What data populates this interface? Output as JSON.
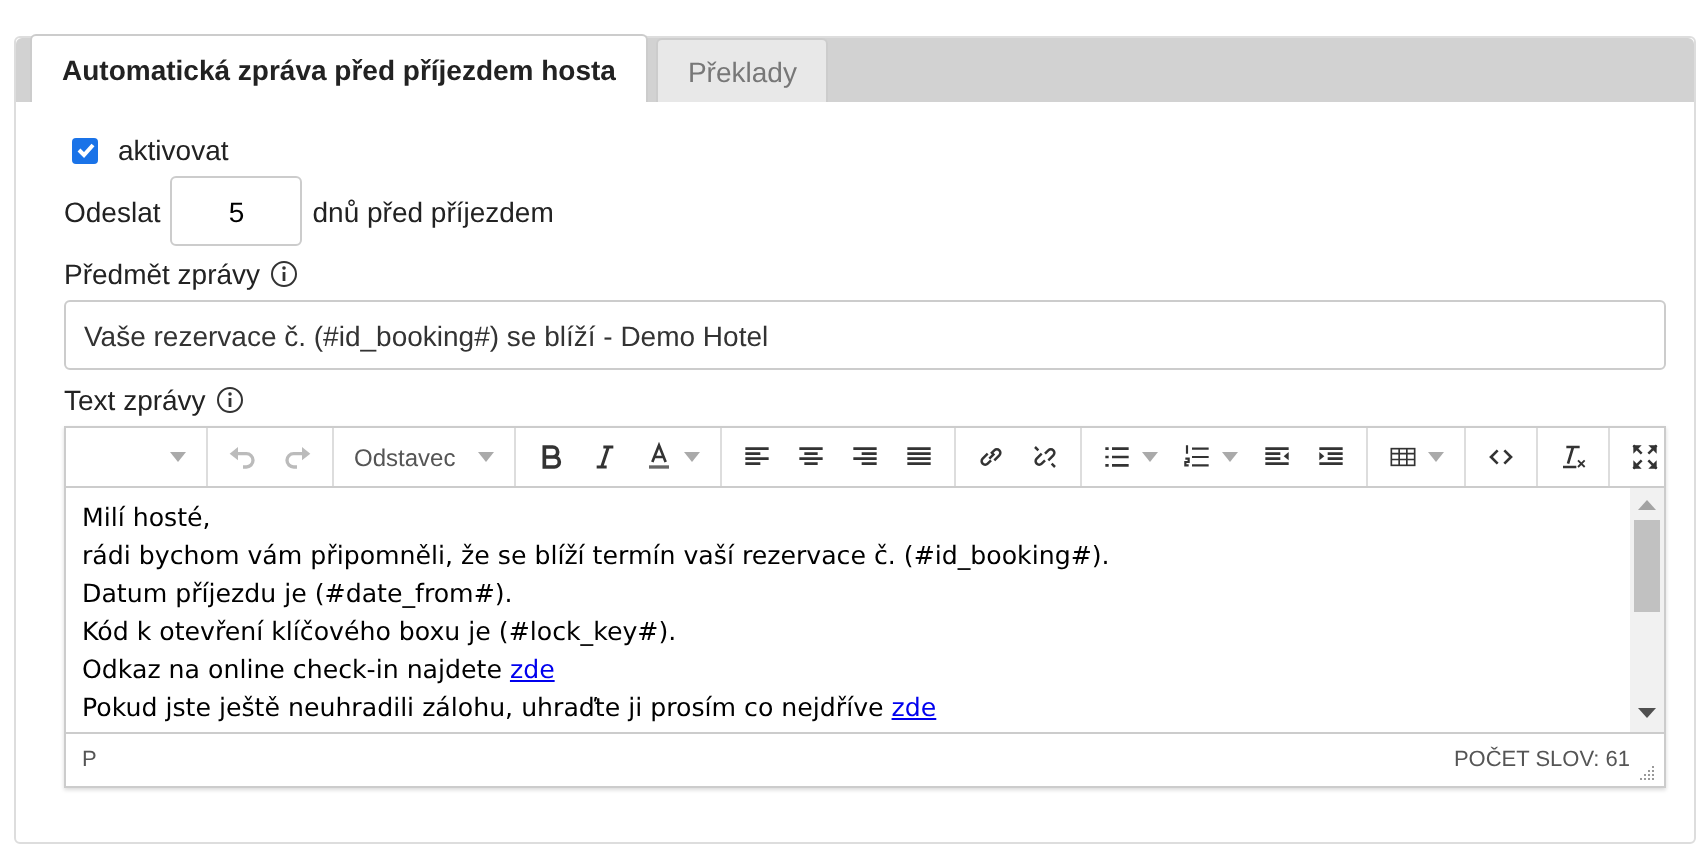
{
  "tabs": [
    {
      "label": "Automatická zpráva před příjezdem hosta",
      "selected": true
    },
    {
      "label": "Překlady",
      "selected": false
    }
  ],
  "activate": {
    "label": "aktivovat",
    "checked": true
  },
  "send": {
    "before": "Odeslat",
    "value": "5",
    "after": "dnů před příjezdem"
  },
  "subject": {
    "label": "Předmět zprávy",
    "value": "Vaše rezervace č. (#id_booking#) se blíží - Demo Hotel"
  },
  "text_label": "Text zprávy",
  "toolbar": [
    [
      {
        "kind": "menu",
        "disabled": false
      }
    ],
    [
      {
        "kind": "undo",
        "disabled": true
      },
      {
        "kind": "redo",
        "disabled": true
      }
    ],
    [
      {
        "kind": "format",
        "label": "Odstavec",
        "disabled": false
      }
    ],
    [
      {
        "kind": "bold",
        "disabled": false
      },
      {
        "kind": "italic",
        "disabled": false
      },
      {
        "kind": "color",
        "disabled": false
      }
    ],
    [
      {
        "kind": "align-left",
        "disabled": false
      },
      {
        "kind": "align-center",
        "disabled": false
      },
      {
        "kind": "align-right",
        "disabled": false
      },
      {
        "kind": "justify",
        "disabled": false
      }
    ],
    [
      {
        "kind": "link",
        "disabled": false
      },
      {
        "kind": "unlink",
        "disabled": false
      }
    ],
    [
      {
        "kind": "bullets",
        "disabled": false
      },
      {
        "kind": "numbers",
        "disabled": false
      },
      {
        "kind": "outdent",
        "disabled": false
      },
      {
        "kind": "indent",
        "disabled": false
      }
    ],
    [
      {
        "kind": "table",
        "disabled": false
      }
    ],
    [
      {
        "kind": "code",
        "disabled": false
      }
    ],
    [
      {
        "kind": "clear",
        "disabled": false
      }
    ],
    [
      {
        "kind": "fullscreen",
        "disabled": false
      }
    ]
  ],
  "lines": [
    {
      "text": "Milí hosté,"
    },
    {
      "text": "rádi bychom vám připomněli, že se blíží termín vaší rezervace č. (#id_booking#)."
    },
    {
      "text": "Datum příjezdu je (#date_from#)."
    },
    {
      "text": "Kód k otevření klíčového boxu je (#lock_key#)."
    },
    {
      "text": "Odkaz na online check-in najdete ",
      "link": "zde"
    },
    {
      "text": "Pokud jste ještě neuhradili zálohu, uhraďte ji prosím co nejdříve ",
      "link": "zde"
    }
  ],
  "status": {
    "path": "P",
    "word_count": "POČET SLOV: 61"
  }
}
